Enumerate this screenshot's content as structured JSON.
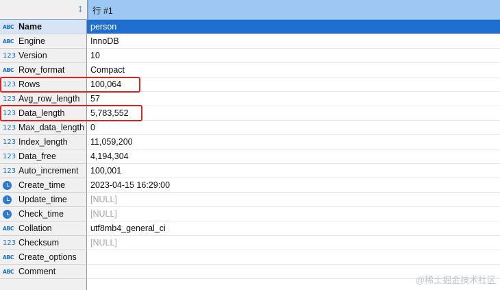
{
  "header": {
    "sort_icon": "sort-arrows-icon",
    "column_title": "行 #1"
  },
  "rows": [
    {
      "name": "Name",
      "type": "abc",
      "value": "person",
      "selected": true
    },
    {
      "name": "Engine",
      "type": "abc",
      "value": "InnoDB"
    },
    {
      "name": "Version",
      "type": "num",
      "value": "10"
    },
    {
      "name": "Row_format",
      "type": "abc",
      "value": "Compact"
    },
    {
      "name": "Rows",
      "type": "num",
      "value": "100,064"
    },
    {
      "name": "Avg_row_length",
      "type": "num",
      "value": "57"
    },
    {
      "name": "Data_length",
      "type": "num",
      "value": "5,783,552"
    },
    {
      "name": "Max_data_length",
      "type": "num",
      "value": "0"
    },
    {
      "name": "Index_length",
      "type": "num",
      "value": "11,059,200"
    },
    {
      "name": "Data_free",
      "type": "num",
      "value": "4,194,304"
    },
    {
      "name": "Auto_increment",
      "type": "num",
      "value": "100,001"
    },
    {
      "name": "Create_time",
      "type": "clock",
      "value": "2023-04-15 16:29:00"
    },
    {
      "name": "Update_time",
      "type": "clock",
      "value": "[NULL]",
      "null": true
    },
    {
      "name": "Check_time",
      "type": "clock",
      "value": "[NULL]",
      "null": true
    },
    {
      "name": "Collation",
      "type": "abc",
      "value": "utf8mb4_general_ci"
    },
    {
      "name": "Checksum",
      "type": "num",
      "value": "[NULL]",
      "null": true
    },
    {
      "name": "Create_options",
      "type": "abc",
      "value": ""
    },
    {
      "name": "Comment",
      "type": "abc",
      "value": ""
    }
  ],
  "type_icons": {
    "abc": "ABC",
    "num": "123"
  },
  "watermark": "@稀土掘金技术社区",
  "colors": {
    "header_bg": "#9cc8f3",
    "selection_bg": "#1f6fd1",
    "highlight_border": "#e02020"
  }
}
